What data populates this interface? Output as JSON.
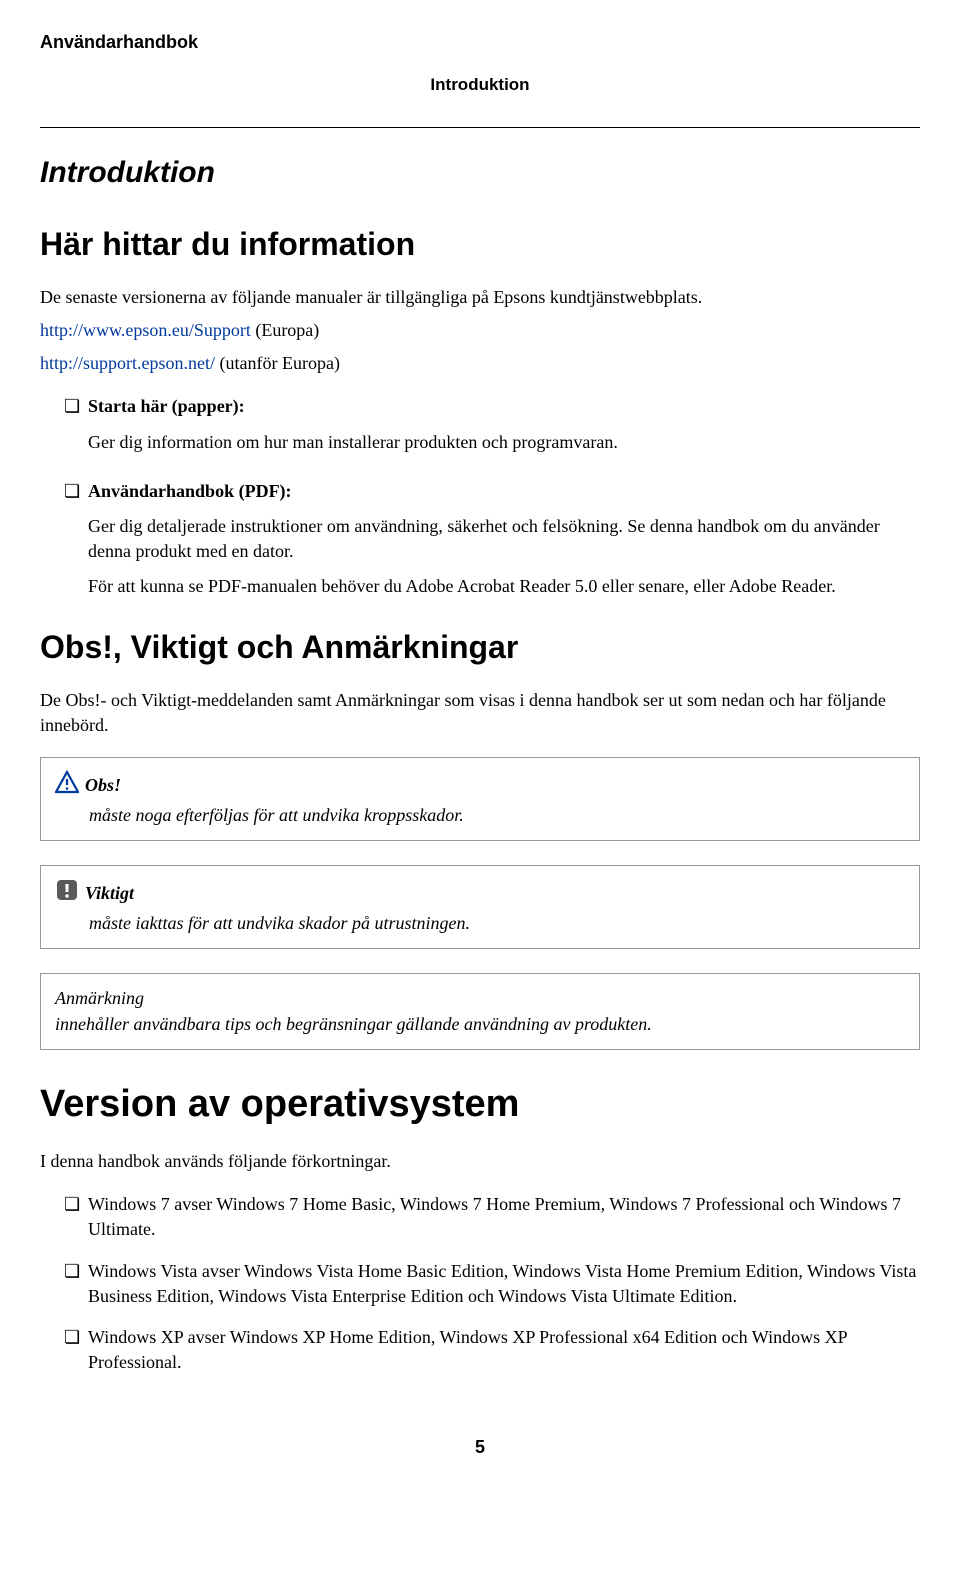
{
  "header": {
    "title": "Användarhandbok",
    "section": "Introduktion"
  },
  "h1": "Introduktion",
  "h2_info": "Här hittar du information",
  "intro": {
    "p1": "De senaste versionerna av följande manualer är tillgängliga på Epsons kundtjänstwebbplats.",
    "link1_text": "http://www.epson.eu/Support",
    "link1_suffix": " (Europa)",
    "link2_text": "http://support.epson.net/",
    "link2_suffix": " (utanför Europa)"
  },
  "manuals": [
    {
      "title": "Starta här (papper):",
      "desc": "Ger dig information om hur man installerar produkten och programvaran."
    },
    {
      "title": "Användarhandbok (PDF):",
      "desc": "Ger dig detaljerade instruktioner om användning, säkerhet och felsökning. Se denna handbok om du använder denna produkt med en dator.",
      "desc2": "För att kunna se PDF-manualen behöver du Adobe Acrobat Reader 5.0 eller senare, eller Adobe Reader."
    }
  ],
  "h2_notes": "Obs!, Viktigt och Anmärkningar",
  "notes_intro": "De Obs!- och Viktigt-meddelanden samt Anmärkningar som visas i denna handbok ser ut som nedan och har följande innebörd.",
  "callouts": {
    "obs": {
      "label": "Obs!",
      "text": "måste noga efterföljas för att undvika kroppsskador."
    },
    "viktigt": {
      "label": "Viktigt",
      "text": "måste iakttas för att undvika skador på utrustningen."
    },
    "anmarkning": {
      "label": "Anmärkning",
      "text": "innehåller användbara tips och begränsningar gällande användning av produkten."
    }
  },
  "h2_os": "Version av operativsystem",
  "os_intro": "I denna handbok används följande förkortningar.",
  "os_list": [
    "Windows 7 avser Windows 7 Home Basic, Windows 7 Home Premium, Windows 7 Professional och Windows 7 Ultimate.",
    "Windows Vista avser Windows Vista Home Basic Edition, Windows Vista Home Premium Edition, Windows Vista Business Edition, Windows Vista Enterprise Edition och Windows Vista Ultimate Edition.",
    "Windows XP avser Windows XP Home Edition, Windows XP Professional x64 Edition och Windows XP Professional."
  ],
  "page_number": "5"
}
